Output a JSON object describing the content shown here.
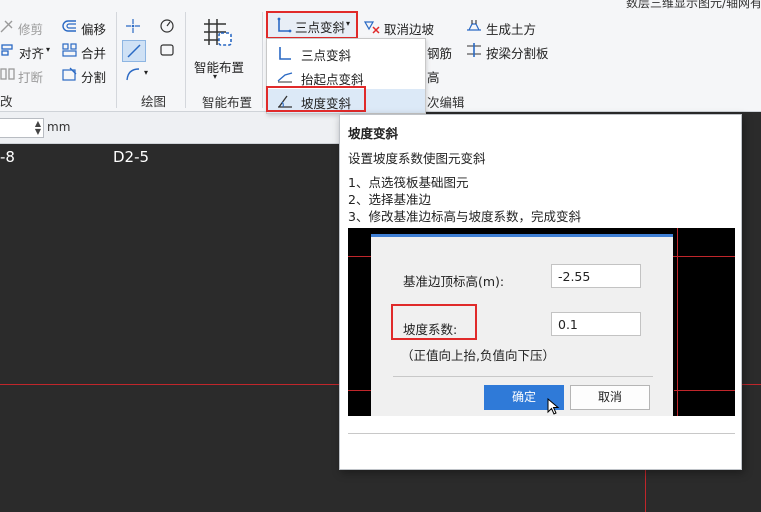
{
  "window": {
    "title_fragment": "数层三维显示图元/轴网有"
  },
  "ribbon": {
    "modify_group": {
      "trim_label": "修剪",
      "align_label": "对齐",
      "break_label": "打断",
      "offset_label": "偏移",
      "merge_label": "合并",
      "split_label": "分割",
      "cut_label": "改"
    },
    "draw_group": {
      "label": "绘图"
    },
    "smart_group": {
      "button_label": "智能布置",
      "label": "智能布置"
    },
    "slope_group": {
      "three_point_button": "三点变斜",
      "cancel_edge_slope": "取消边坡",
      "rebar_fragment": "钢筋",
      "height_fragment": "高",
      "secondary_edit_fragment": "次编辑"
    },
    "earthwork_group": {
      "generate_earthwork": "生成土方",
      "split_by_beam": "按梁分割板"
    }
  },
  "dropdown": {
    "items": [
      {
        "label": "三点变斜"
      },
      {
        "label": "抬起点变斜"
      },
      {
        "label": "坡度变斜"
      }
    ],
    "selected_index": 2
  },
  "toolbar2": {
    "unit": "mm"
  },
  "canvas": {
    "labels": [
      "-8",
      "D2-5"
    ],
    "axis_color": "#c0262b"
  },
  "tooltip": {
    "title": "坡度变斜",
    "description": "设置坡度系数使图元变斜",
    "steps": [
      "1、点选筏板基础图元",
      "2、选择基准边",
      "3、修改基准边标高与坡度系数，完成变斜"
    ],
    "example": {
      "base_edge_label": "基准边顶标高(m):",
      "base_edge_value": "-2.55",
      "slope_label": "坡度系数:",
      "slope_value": "0.1",
      "hint": "（正值向上抬,负值向下压）",
      "ok_label": "确定",
      "cancel_label": "取消"
    }
  },
  "colors": {
    "highlight": "#e02a2a",
    "accent": "#2f7ad8",
    "selected_bg": "#dce9f7"
  }
}
